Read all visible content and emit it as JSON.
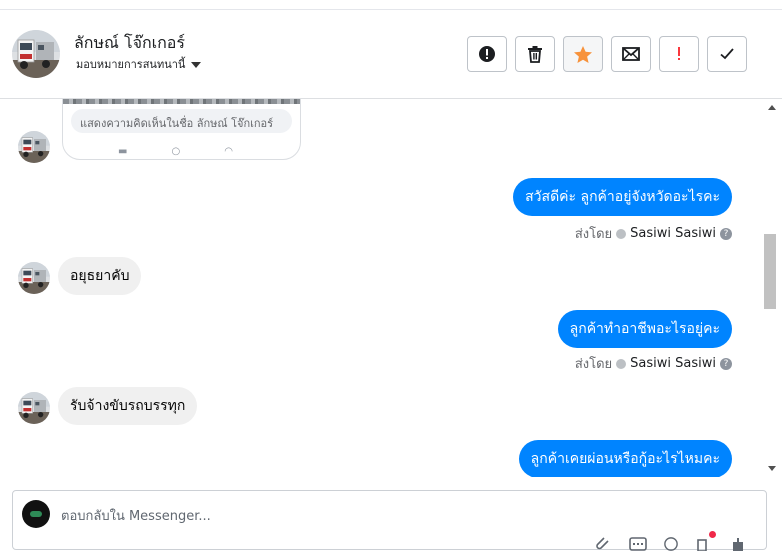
{
  "header": {
    "contact_name": "ลักษณ์ โจ๊กเกอร์",
    "assign_label": "มอบหมายการสนทนานี้",
    "toolbar": [
      {
        "name": "spam-button",
        "icon": "alert-circle-icon"
      },
      {
        "name": "delete-button",
        "icon": "trash-icon"
      },
      {
        "name": "star-button",
        "icon": "star-icon"
      },
      {
        "name": "unread-button",
        "icon": "envelope-icon"
      },
      {
        "name": "follow-up-button",
        "icon": "exclamation-icon"
      },
      {
        "name": "done-button",
        "icon": "check-icon"
      }
    ],
    "colors": {
      "star": "#f7923b",
      "follow_up": "#fa383e"
    }
  },
  "thread": {
    "card_comment_placeholder": "แสดงความคิดเห็นในชื่อ ลักษณ์ โจ๊กเกอร์",
    "messages": [
      {
        "direction": "out",
        "text": "สวัสดีค่ะ ลูกค้าอยู่จังหวัดอะไรคะ",
        "sent_by_label": "ส่งโดย",
        "sender": "Sasiwi Sasiwi"
      },
      {
        "direction": "in",
        "text": "อยุธยาคับ"
      },
      {
        "direction": "out",
        "text": "ลูกค้าทำอาชีพอะไรอยู่คะ",
        "sent_by_label": "ส่งโดย",
        "sender": "Sasiwi Sasiwi"
      },
      {
        "direction": "in",
        "text": "รับจ้างขับรถบรรทุก"
      },
      {
        "direction": "out",
        "text": "ลูกค้าเคยผ่อนหรือกู้อะไรไหมคะ"
      }
    ],
    "colors": {
      "outgoing": "#0084ff",
      "incoming": "#f0f0f0"
    }
  },
  "composer": {
    "placeholder": "ตอบกลับใน Messenger...",
    "tools": [
      "attach-icon",
      "gif-icon",
      "emoji-icon",
      "saved-reply-icon",
      "thumbs-up-icon"
    ]
  }
}
